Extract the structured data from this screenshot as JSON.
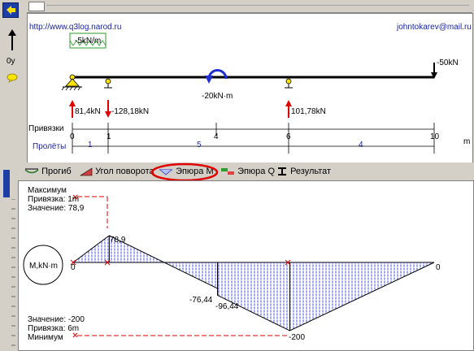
{
  "header": {
    "website": "http://www.q3log.narod.ru",
    "email": "johntokarev@mail.ru"
  },
  "left_toolbar": {
    "axis_label": "0y"
  },
  "beam": {
    "distributed_load": "-5kN/m",
    "point_load": "-50kN",
    "moment": "-20kN·m",
    "reactions": [
      "81,4kN",
      "-128,18kN",
      "101,78kN"
    ],
    "bindings_label": "Привязки",
    "spans_label": "Пролёты",
    "ticks": [
      "0",
      "1",
      "4",
      "6",
      "10"
    ],
    "unit": "m",
    "spans": [
      "1",
      "5",
      "4"
    ]
  },
  "tabs": {
    "deflection": "Прогиб",
    "rotation": "Угол поворота",
    "moment": "Эпюра M",
    "shear": "Эпюра Q",
    "result": "Результат"
  },
  "diagram": {
    "circle_label": "M,kN·m",
    "max_title": "Максимум",
    "max_position": "Привязка: 1m",
    "max_value": "Значение: 78,9",
    "min_value": "Значение: -200",
    "min_position": "Привязка: 6m",
    "min_title": "Минимум",
    "value_labels": [
      "78,9",
      "0",
      "-76,44",
      "-96,44",
      "-200",
      "0"
    ]
  },
  "chart_data": {
    "type": "area",
    "title": "Эпюра M",
    "xlabel": "m",
    "ylabel": "M,kN·m",
    "x": [
      0,
      1,
      4,
      4,
      6,
      10
    ],
    "y": [
      0,
      78.9,
      -76.44,
      -96.44,
      -200,
      0
    ],
    "xlim": [
      0,
      10
    ]
  },
  "colors": {
    "beam": "#000000",
    "reaction": "#e00000",
    "moment_arrow": "#1d2fd1",
    "hatch": "#2d3ad6",
    "tab_highlight": "#e00000",
    "dashed_marker": "#e00000",
    "link_text": "#1a24a0"
  }
}
